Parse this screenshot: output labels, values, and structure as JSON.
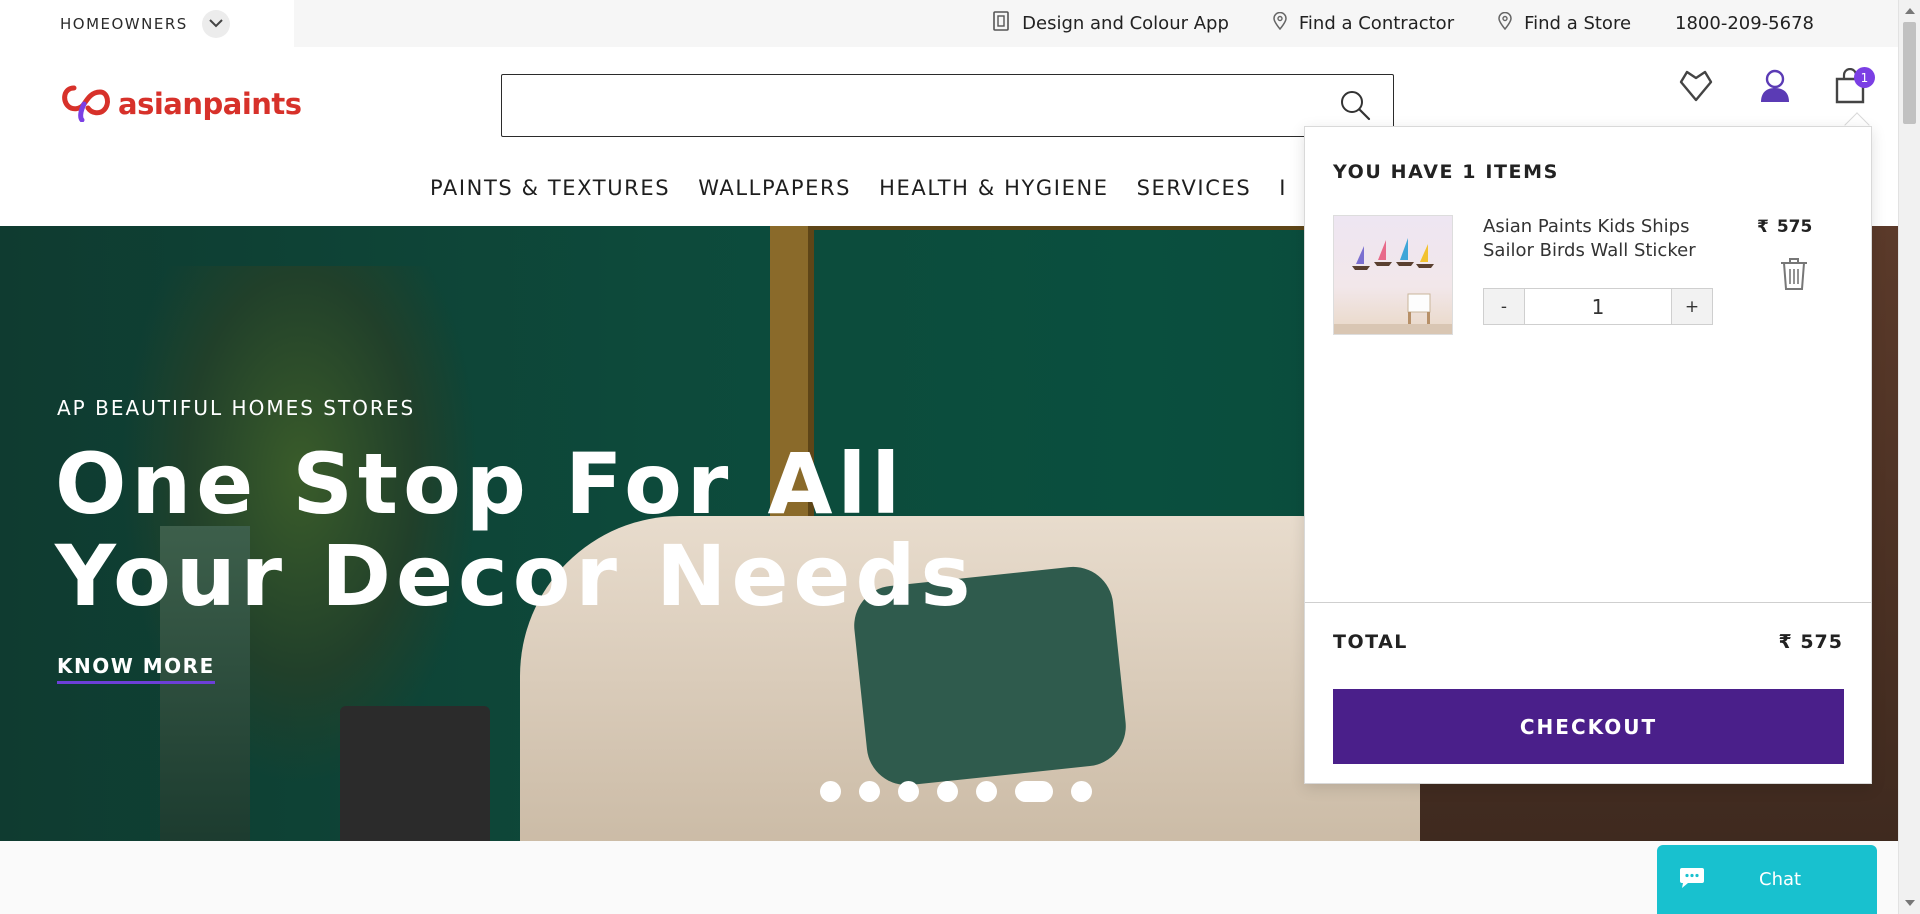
{
  "topbar": {
    "audience": "HOMEOWNERS",
    "links": [
      {
        "label": "Design and Colour App",
        "icon": "app-icon"
      },
      {
        "label": "Find a Contractor",
        "icon": "location-pin-icon"
      },
      {
        "label": "Find a Store",
        "icon": "location-pin-icon"
      },
      {
        "label": "1800-209-5678",
        "icon": ""
      }
    ]
  },
  "header": {
    "logo_text": "asianpaints",
    "search": {
      "value": "",
      "placeholder": ""
    },
    "cart_count": "1"
  },
  "nav": {
    "items": [
      "PAINTS & TEXTURES",
      "WALLPAPERS",
      "HEALTH & HYGIENE",
      "SERVICES",
      "I"
    ]
  },
  "hero": {
    "eyebrow": "AP BEAUTIFUL HOMES STORES",
    "headline_line1": "One Stop For All",
    "headline_line2": "Your Decor Needs",
    "cta": "KNOW MORE",
    "slides_total": 7,
    "active_slide": 6
  },
  "cart": {
    "title": "YOU HAVE 1 ITEMS",
    "item": {
      "name": "Asian Paints Kids Ships Sailor Birds Wall Sticker",
      "currency": "₹",
      "price": "575",
      "quantity": "1",
      "decrement": "-",
      "increment": "+"
    },
    "total_label": "TOTAL",
    "total_value": "₹ 575",
    "checkout_label": "CHECKOUT"
  },
  "chat": {
    "label": "Chat"
  },
  "colors": {
    "brand_red": "#d7312a",
    "checkout_purple": "#4a1f8a",
    "badge_purple": "#7b3fe4",
    "chat_teal": "#18c1cf"
  }
}
